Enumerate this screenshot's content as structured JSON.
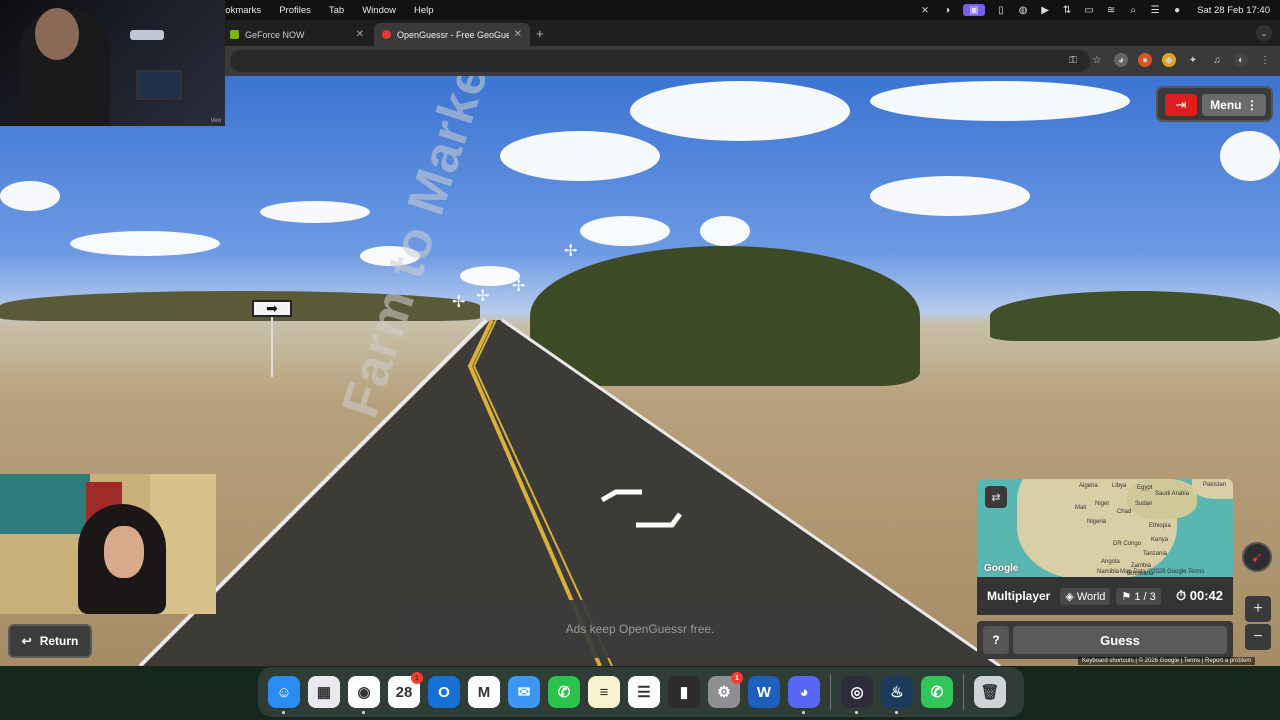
{
  "menubar": {
    "menus": [
      "ookmarks",
      "Profiles",
      "Tab",
      "Window",
      "Help"
    ],
    "clock": "Sat 28 Feb  17:40"
  },
  "tabs": [
    {
      "title": "GeForce NOW",
      "color": "#76b900"
    },
    {
      "title": "OpenGuessr - Free GeoGues",
      "color": "#e53935"
    }
  ],
  "webcam1": {
    "label": "Veo"
  },
  "sign": {
    "arrow": "➡"
  },
  "road_label": "Farm to Market Rd",
  "top_right": {
    "exit_icon": "exit-icon",
    "menu_label": "Menu"
  },
  "return_button": {
    "label": "Return"
  },
  "ads_text": "Ads keep OpenGuessr free.",
  "minimap": {
    "places": [
      "Algeria",
      "Libya",
      "Egypt",
      "Pakistan",
      "Saudi Arabia",
      "Mali",
      "Niger",
      "Chad",
      "Sudan",
      "Nigeria",
      "Ethiopia",
      "Kenya",
      "Tanzania",
      "DR Congo",
      "Angola",
      "Zambia",
      "Namibia",
      "Botswana"
    ],
    "google": "Google",
    "footer": "Map Data ©2026 Google   Terms"
  },
  "status": {
    "mode": "Multiplayer",
    "region": "World",
    "round": "1 / 3",
    "timer": "00:42"
  },
  "guess": {
    "help": "?",
    "label": "Guess"
  },
  "google_footer": "Keyboard shortcuts  |  © 2026 Google  |  Terms  |  Report a problem",
  "dock": [
    {
      "name": "Finder",
      "color": "#2a8cf0",
      "glyph": "☺",
      "dot": true
    },
    {
      "name": "Launchpad",
      "color": "#e8e8ee",
      "glyph": "▦",
      "dot": false
    },
    {
      "name": "Chrome",
      "color": "#ffffff",
      "glyph": "◉",
      "dot": true
    },
    {
      "name": "Calendar",
      "color": "#ffffff",
      "glyph": "28",
      "badge": "1",
      "dot": false
    },
    {
      "name": "Outlook",
      "color": "#1670d4",
      "glyph": "O",
      "dot": false
    },
    {
      "name": "Gmail",
      "color": "#ffffff",
      "glyph": "M",
      "dot": false
    },
    {
      "name": "Mail",
      "color": "#3b97f3",
      "glyph": "✉",
      "dot": false
    },
    {
      "name": "WhatsApp",
      "color": "#2ac34d",
      "glyph": "✆",
      "dot": false
    },
    {
      "name": "Notes",
      "color": "#f7f2d0",
      "glyph": "≡",
      "dot": false
    },
    {
      "name": "Reminders",
      "color": "#ffffff",
      "glyph": "☰",
      "dot": false
    },
    {
      "name": "Gallery",
      "color": "#2c2c2c",
      "glyph": "▮",
      "dot": false
    },
    {
      "name": "System Settings",
      "color": "#8e8e93",
      "glyph": "⚙",
      "badge": "1",
      "dot": false
    },
    {
      "name": "Word",
      "color": "#1d5fbd",
      "glyph": "W",
      "dot": false
    },
    {
      "name": "Discord",
      "color": "#5865f2",
      "glyph": "◕",
      "dot": true
    },
    {
      "name": "OBS",
      "color": "#2b2e3a",
      "glyph": "◎",
      "dot": true
    },
    {
      "name": "Steam",
      "color": "#1b3a5c",
      "glyph": "♨",
      "dot": true
    },
    {
      "name": "Phone",
      "color": "#32c65a",
      "glyph": "✆",
      "dot": false
    },
    {
      "name": "Trash",
      "color": "#cfd3d6",
      "glyph": "🗑",
      "dot": false
    }
  ]
}
